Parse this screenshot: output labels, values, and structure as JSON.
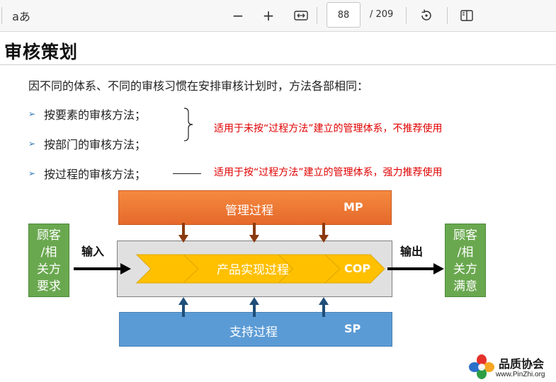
{
  "toolbar": {
    "read_aloud_icon": "read-aloud-icon",
    "read_aloud_glyph": "aあ",
    "zoom_out_glyph": "−",
    "zoom_in_glyph": "+",
    "current_page": "88",
    "total_pages": "/ 209"
  },
  "slide": {
    "title": "审核策划",
    "intro": "因不同的体系、不同的审核习惯在安排审核计划时，方法各部相同：",
    "bullets": [
      {
        "label": "按要素的审核方法；"
      },
      {
        "label": "按部门的审核方法；"
      },
      {
        "label": "按过程的审核方法；"
      }
    ],
    "notes": [
      "适用于未按“过程方法”建立的管理体系，不推荐使用",
      "适用于按“过程方法”建立的管理体系，强力推荐使用"
    ],
    "note_color": "#e00000",
    "diagram": {
      "mp_label": "管理过程",
      "mp_abbr": "MP",
      "cop_label": "产品实现过程",
      "cop_abbr": "COP",
      "sp_label": "支持过程",
      "sp_abbr": "SP",
      "input_label": "输入",
      "output_label": "输出",
      "left_box_lines": [
        "顾客",
        "/相",
        "关方",
        "要求"
      ],
      "right_box_lines": [
        "顾客",
        "/相",
        "关方",
        "满意"
      ],
      "colors": {
        "mp": "#ed7d31",
        "sp": "#5b9bd5",
        "cop": "#ffc000",
        "customer": "#6aa84f",
        "mp_arrow": "#8b3a0f",
        "sp_arrow": "#1f4e79"
      }
    }
  },
  "logo": {
    "name": "品质协会",
    "url": "www.PinZhi.org"
  }
}
